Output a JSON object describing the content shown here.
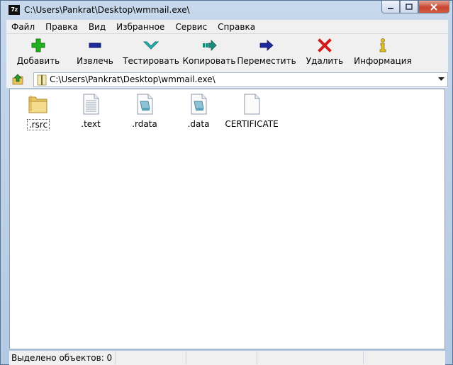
{
  "window": {
    "title": "C:\\Users\\Pankrat\\Desktop\\wmmail.exe\\",
    "app_icon_text": "7z",
    "buttons": {
      "minimize": "minimize-icon",
      "maximize": "maximize-icon",
      "close": "close-icon"
    }
  },
  "menu": {
    "items": [
      {
        "label": "Файл"
      },
      {
        "label": "Правка"
      },
      {
        "label": "Вид"
      },
      {
        "label": "Избранное"
      },
      {
        "label": "Сервис"
      },
      {
        "label": "Справка"
      }
    ]
  },
  "toolbar": {
    "buttons": [
      {
        "label": "Добавить",
        "icon": "plus-icon",
        "color": "#22b01e"
      },
      {
        "label": "Извлечь",
        "icon": "minus-icon",
        "color": "#1c2a9c"
      },
      {
        "label": "Тестировать",
        "icon": "check-chevron-icon",
        "color": "#2cb7b0"
      },
      {
        "label": "Копировать",
        "icon": "copy-arrow-icon",
        "color": "#1a8a7a"
      },
      {
        "label": "Переместить",
        "icon": "move-arrow-icon",
        "color": "#1c2a9c"
      },
      {
        "label": "Удалить",
        "icon": "delete-x-icon",
        "color": "#d41a1a"
      },
      {
        "label": "Информация",
        "icon": "info-icon",
        "color": "#e2c21a"
      }
    ]
  },
  "address": {
    "path": "C:\\Users\\Pankrat\\Desktop\\wmmail.exe\\"
  },
  "files": [
    {
      "name": ".rsrc",
      "type": "folder",
      "focused": true
    },
    {
      "name": ".text",
      "type": "text-file"
    },
    {
      "name": ".rdata",
      "type": "data-file"
    },
    {
      "name": ".data",
      "type": "data-file"
    },
    {
      "name": "CERTIFICATE",
      "type": "blank-file"
    }
  ],
  "status": {
    "selected": "Выделено объектов: 0",
    "cells": [
      "",
      "",
      "",
      ""
    ]
  }
}
